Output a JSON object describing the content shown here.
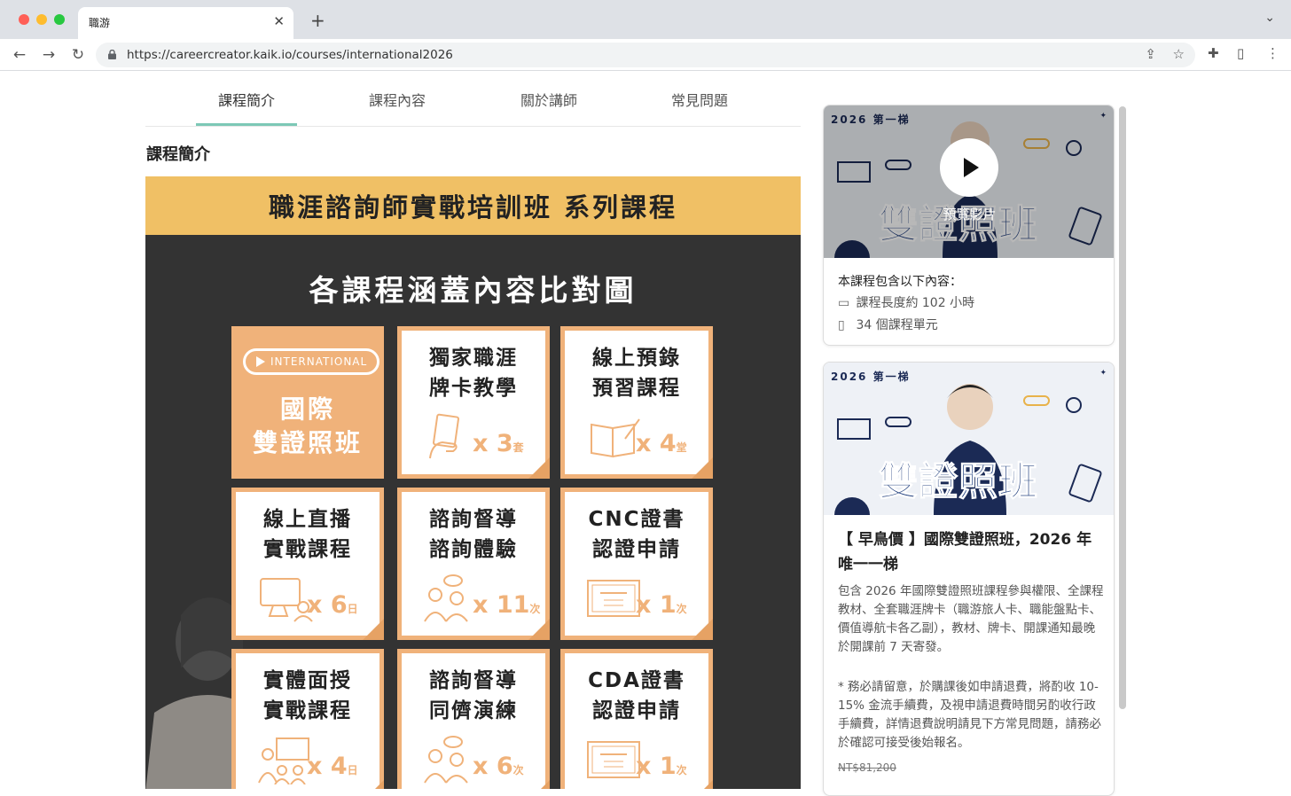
{
  "browser": {
    "tab_title": "職游",
    "url": "https://careercreator.kaik.io/courses/international2026"
  },
  "course_tabs": [
    "課程簡介",
    "課程內容",
    "關於講師",
    "常見問題"
  ],
  "section_title": "課程簡介",
  "banner": {
    "header": "職涯諮詢師實戰培訓班 系列課程",
    "subtitle": "各課程涵蓋內容比對圖",
    "intl_pill": "INTERNATIONAL",
    "intl_title": "國際\n雙證照班",
    "cells": [
      {
        "title": "獨家職涯\n牌卡教學",
        "count": "3",
        "unit": "套",
        "icon": "card-hand-icon"
      },
      {
        "title": "線上預錄\n預習課程",
        "count": "4",
        "unit": "堂",
        "icon": "book-pen-icon"
      },
      {
        "title": "線上直播\n實戰課程",
        "count": "6",
        "unit": "日",
        "icon": "live-screen-icon"
      },
      {
        "title": "諮詢督導\n諮詢體驗",
        "count": "11",
        "unit": "次",
        "icon": "people-chat-icon"
      },
      {
        "title": "CNC證書\n認證申請",
        "count": "1",
        "unit": "次",
        "icon": "certificate-icon"
      },
      {
        "title": "實體面授\n實戰課程",
        "count": "4",
        "unit": "日",
        "icon": "classroom-icon"
      },
      {
        "title": "諮詢督導\n同儕演練",
        "count": "6",
        "unit": "次",
        "icon": "people-chat-icon"
      },
      {
        "title": "CDA證書\n認證申請",
        "count": "1",
        "unit": "次",
        "icon": "certificate-icon"
      }
    ]
  },
  "sidebar": {
    "video": {
      "year_badge": "2026 第一梯",
      "title": "雙證照班",
      "preview_label": "預覽影片",
      "includes_title": "本課程包含以下內容：",
      "includes": [
        {
          "icon": "video-icon",
          "text": "課程長度約 102 小時"
        },
        {
          "icon": "file-icon",
          "text": "34 個課程單元"
        }
      ]
    },
    "product": {
      "year_badge": "2026 第一梯",
      "title_art": "雙證照班",
      "title": "【 早鳥價 】國際雙證照班，2026 年唯一一梯",
      "description": "包含 2026 年國際雙證照班課程參與權限、全課程教材、全套職涯牌卡（職游旅人卡、職能盤點卡、價值導航卡各乙副），教材、牌卡、開課通知最晚於開課前 7 天寄發。",
      "note": "* 務必請留意，於購課後如申請退費，將酌收 10-15% 金流手續費，及視申請退費時間另酌收行政手續費，詳情退費說明請見下方常見問題，請務必於確認可接受後始報名。",
      "original_price": "NT$81,200"
    }
  },
  "colors": {
    "accent_teal": "#7cc8b6",
    "banner_yellow": "#f0c065",
    "cell_orange": "#f0b27a",
    "banner_dark": "#333333",
    "navy": "#1b3a7a"
  }
}
